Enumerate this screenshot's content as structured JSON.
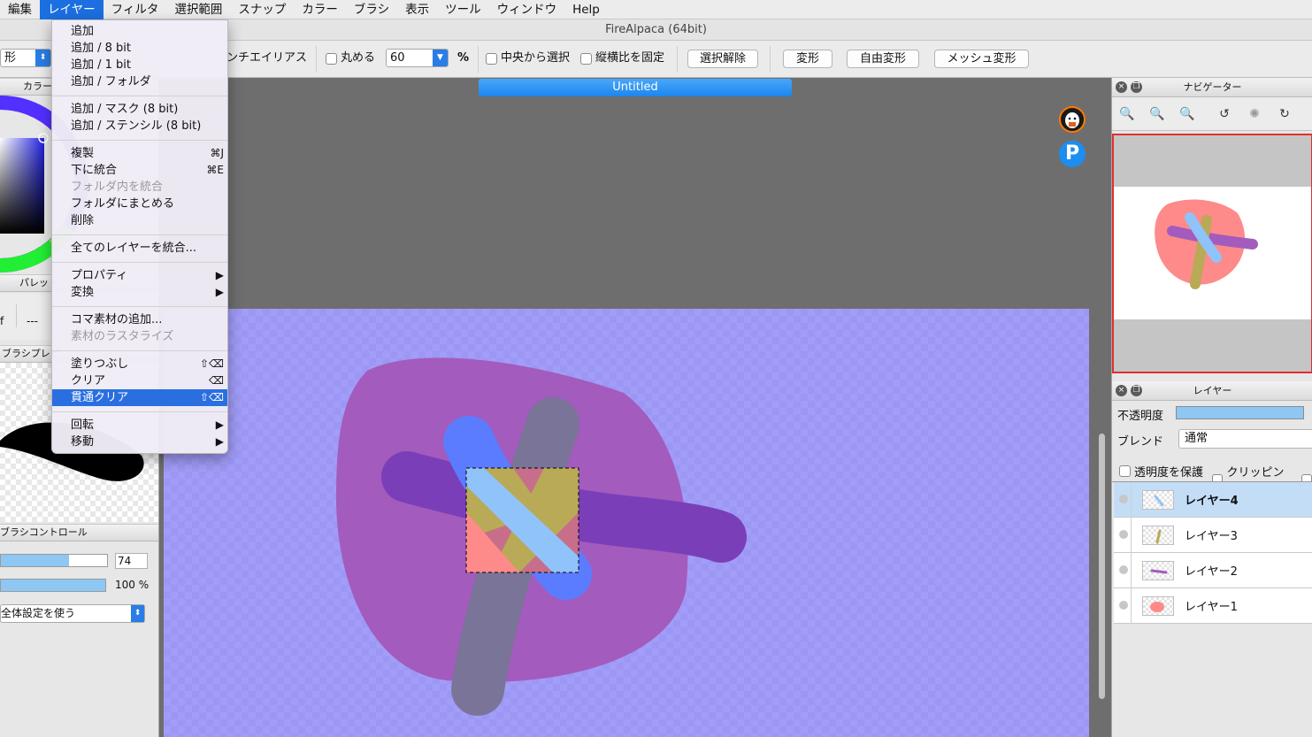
{
  "menubar": {
    "items": [
      "編集",
      "レイヤー",
      "フィルタ",
      "選択範囲",
      "スナップ",
      "カラー",
      "ブラシ",
      "表示",
      "ツール",
      "ウィンドウ",
      "Help"
    ],
    "active": "レイヤー"
  },
  "window": {
    "title": "FireAlpaca (64bit)"
  },
  "toolbar": {
    "mode_value": "形",
    "antialias_label": "ンチエイリアス",
    "round_label": "丸める",
    "round_value": "60",
    "percent": "%",
    "center_select_label": "中央から選択",
    "fix_ratio_label": "縦横比を固定",
    "deselect_button": "選択解除",
    "transform_button": "変形",
    "free_transform_button": "自由変形",
    "mesh_transform_button": "メッシュ変形"
  },
  "document": {
    "tab_title": "Untitled"
  },
  "left_panel": {
    "color_header": "カラー",
    "palette_header": "パレット",
    "brush_preview_header": "ブラシプレビ",
    "palette_dashes": "---",
    "brush_control_header": "ブラシコントロール",
    "size_value": "74",
    "opacity_value": "100 %",
    "global_setting": "全体設定を使う",
    "trash_glyph": "f"
  },
  "layer_menu": {
    "items": [
      {
        "label": "追加",
        "shortcut": "",
        "disabled": false
      },
      {
        "label": "追加 / 8 bit",
        "shortcut": "",
        "disabled": false
      },
      {
        "label": "追加 / 1 bit",
        "shortcut": "",
        "disabled": false
      },
      {
        "label": "追加 / フォルダ",
        "shortcut": "",
        "disabled": false
      },
      {
        "label": "追加 / マスク (8 bit)",
        "shortcut": "",
        "disabled": false
      },
      {
        "label": "追加 / ステンシル (8 bit)",
        "shortcut": "",
        "disabled": false
      },
      {
        "label": "複製",
        "shortcut": "⌘J",
        "disabled": false
      },
      {
        "label": "下に統合",
        "shortcut": "⌘E",
        "disabled": false
      },
      {
        "label": "フォルダ内を統合",
        "shortcut": "",
        "disabled": true
      },
      {
        "label": "フォルダにまとめる",
        "shortcut": "",
        "disabled": false
      },
      {
        "label": "削除",
        "shortcut": "",
        "disabled": false
      },
      {
        "label": "全てのレイヤーを統合...",
        "shortcut": "",
        "disabled": false
      },
      {
        "label": "プロパティ",
        "shortcut": "▶",
        "disabled": false
      },
      {
        "label": "変換",
        "shortcut": "▶",
        "disabled": false
      },
      {
        "label": "コマ素材の追加...",
        "shortcut": "",
        "disabled": false
      },
      {
        "label": "素材のラスタライズ",
        "shortcut": "",
        "disabled": true
      },
      {
        "label": "塗りつぶし",
        "shortcut": "⇧⌫",
        "disabled": false
      },
      {
        "label": "クリア",
        "shortcut": "⌫",
        "disabled": false
      },
      {
        "label": "貫通クリア",
        "shortcut": "⇧⌫",
        "disabled": false,
        "highlighted": true
      },
      {
        "label": "回転",
        "shortcut": "▶",
        "disabled": false
      },
      {
        "label": "移動",
        "shortcut": "▶",
        "disabled": false
      }
    ]
  },
  "navigator": {
    "title": "ナビゲーター"
  },
  "layers_panel": {
    "title": "レイヤー",
    "opacity_label": "不透明度",
    "blend_label": "ブレンド",
    "blend_value": "通常",
    "protect_alpha_label": "透明度を保護",
    "clipping_label": "クリッピング",
    "layers": [
      {
        "name": "レイヤー4",
        "selected": true
      },
      {
        "name": "レイヤー3",
        "selected": false
      },
      {
        "name": "レイヤー2",
        "selected": false
      },
      {
        "name": "レイヤー1",
        "selected": false
      }
    ]
  },
  "colors": {
    "accent": "#1b6fe0",
    "canvas_bg": "#9c97f5",
    "blob": "#a35bbd",
    "purple_stroke": "#7a3fb8",
    "blue_stroke": "#5b7cff",
    "gray_stroke": "#7a7498",
    "selection_fill": "#8fc3fa",
    "nav_blob": "#ff8a8a"
  }
}
